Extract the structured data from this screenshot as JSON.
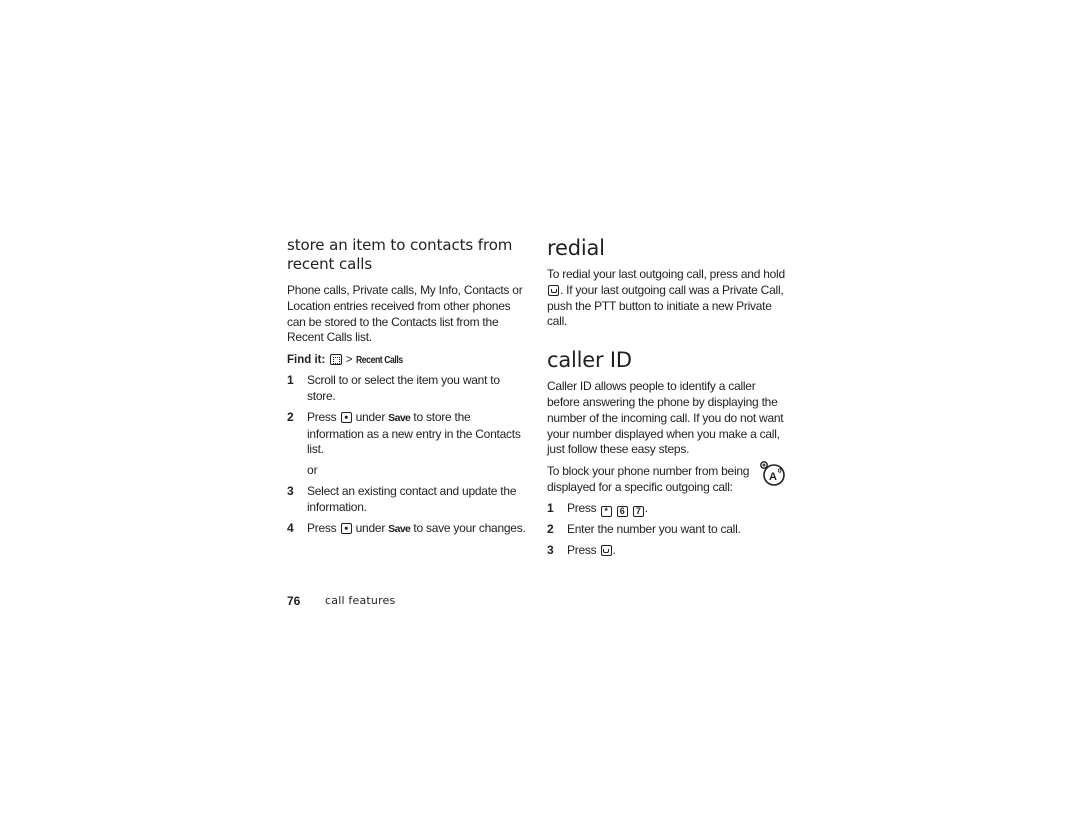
{
  "left": {
    "heading": "store an item to contacts from recent calls",
    "intro": "Phone calls, Private calls, My Info, Contacts or Location entries received from other phones can be stored to the Contacts list from the Recent Calls list.",
    "find_it": {
      "label": "Find it:",
      "icon": "menu-key-icon",
      "separator": ">",
      "path": "Recent Calls"
    },
    "steps": [
      {
        "num": "1",
        "text": "Scroll to or select the item you want to store."
      },
      {
        "num": "2",
        "pre": "Press",
        "key": "center-select-key",
        "mid": "under",
        "softkey": "Save",
        "post": "to store the information as a new entry in the Contacts list."
      },
      {
        "num": "3",
        "text": "Select an existing contact and update the information."
      },
      {
        "num": "4",
        "pre": "Press",
        "key": "center-select-key",
        "mid": "under",
        "softkey": "Save",
        "post": "to save your changes."
      }
    ],
    "or_text": "or"
  },
  "right": {
    "redial": {
      "heading": "redial",
      "text_pre": "To redial your last outgoing call, press and hold",
      "key": "send-key",
      "text_post": ". If your last outgoing call was a Private Call, push the PTT button to initiate a new Private call."
    },
    "caller_id": {
      "heading": "caller ID",
      "intro": "Caller ID allows people to identify a caller before answering the phone by displaying the number of the incoming call. If you do not want your number displayed when you make a call, just follow these easy steps.",
      "block_text": "To block your phone number from being displayed for a specific outgoing call:",
      "feature_icon": "network-feature-icon",
      "steps": [
        {
          "num": "1",
          "pre": "Press",
          "keys": [
            "*",
            "6",
            "7"
          ],
          "post": "."
        },
        {
          "num": "2",
          "text": "Enter the number you want to call."
        },
        {
          "num": "3",
          "pre": "Press",
          "key": "send-key",
          "post": "."
        }
      ]
    }
  },
  "footer": {
    "page_number": "76",
    "section": "call features"
  }
}
